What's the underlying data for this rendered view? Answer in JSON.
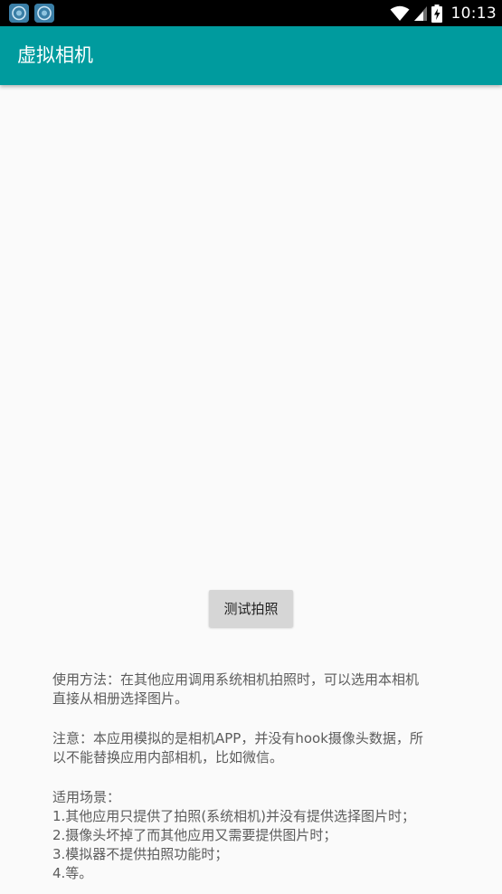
{
  "status_bar": {
    "time": "10:13",
    "colors": {
      "background": "#000000",
      "text": "#ffffff"
    },
    "notification_icons": [
      "app-notification-icon",
      "app-notification-icon"
    ],
    "status_icons": [
      "wifi-icon",
      "cell-signal-icon",
      "battery-charging-icon"
    ]
  },
  "app_bar": {
    "title": "虚拟相机",
    "colors": {
      "background": "#009b9e",
      "text": "#ffffff"
    }
  },
  "main": {
    "button_label": "测试拍照",
    "usage": {
      "lines": [
        "使用方法：在其他应用调用系统相机拍照时，可以选用本相机",
        "直接从相册选择图片。"
      ]
    },
    "note": {
      "lines": [
        "注意：本应用模拟的是相机APP，并没有hook摄像头数据，所",
        "以不能替换应用内部相机，比如微信。"
      ]
    },
    "scenarios": {
      "title": "适用场景：",
      "items": [
        "1.其他应用只提供了拍照(系统相机)并没有提供选择图片时；",
        "2.摄像头坏掉了而其他应用又需要提供图片时；",
        "3.模拟器不提供拍照功能时；",
        "4.等。"
      ]
    }
  }
}
